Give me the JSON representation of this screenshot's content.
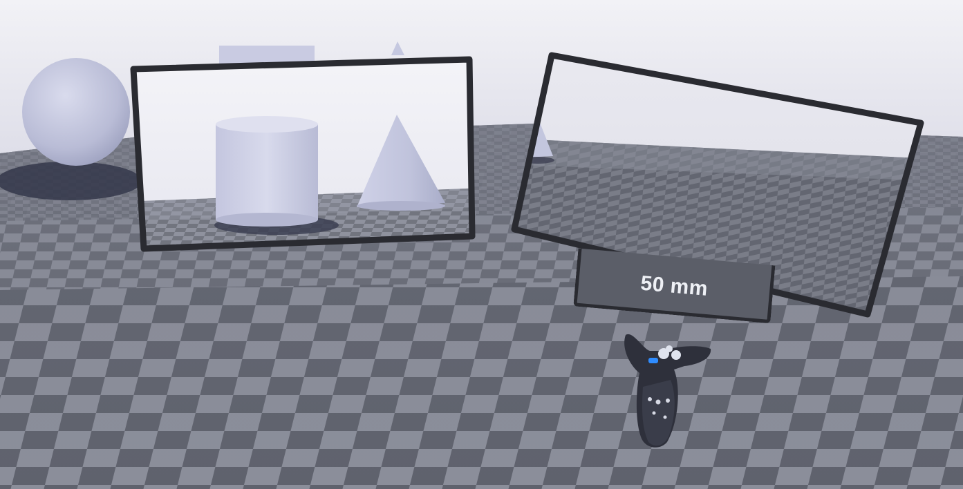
{
  "viewport": {
    "description_free": true
  },
  "camera_preview": {
    "focal_length_label": "50 mm"
  },
  "colors": {
    "sky": "#ececf3",
    "floor_light": "#858894",
    "floor_dark": "#5f626d",
    "object": "#c2c4dc",
    "frame": "#2a2b31",
    "label_bg": "#5b5e68",
    "controller_accent": "#2f8cff"
  },
  "icons": {
    "controller": "vr-controller-icon"
  }
}
